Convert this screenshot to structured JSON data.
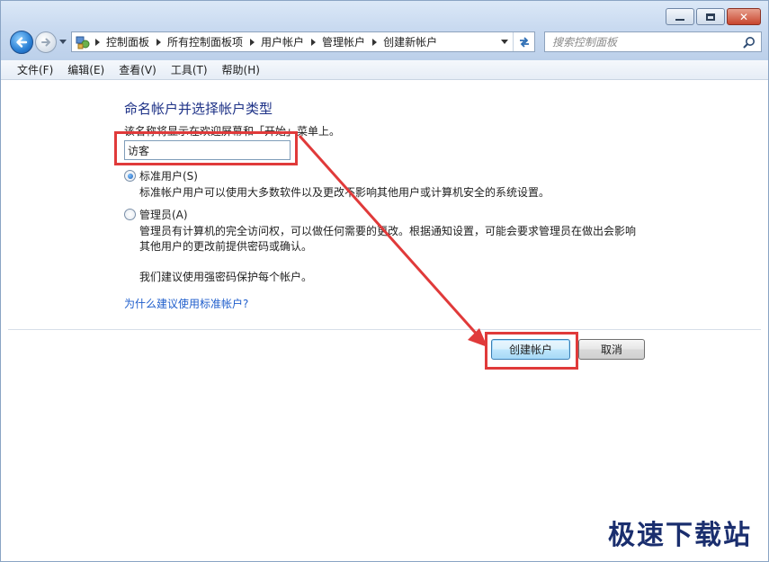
{
  "window": {
    "controls": {
      "minimize": "minimize",
      "maximize": "maximize",
      "close": "close"
    }
  },
  "nav": {
    "breadcrumbs": [
      "控制面板",
      "所有控制面板项",
      "用户帐户",
      "管理帐户",
      "创建新帐户"
    ]
  },
  "search": {
    "placeholder": "搜索控制面板"
  },
  "menu": [
    "文件(F)",
    "编辑(E)",
    "查看(V)",
    "工具(T)",
    "帮助(H)"
  ],
  "form": {
    "heading": "命名帐户并选择帐户类型",
    "description": "该名称将显示在欢迎屏幕和「开始」菜单上。",
    "account_name_value": "访客",
    "options": [
      {
        "label": "标准用户(S)",
        "selected": true,
        "description": [
          "标准帐户用户可以使用大多数软件以及更改不影响其他用户或计算机安全的系统设置。"
        ]
      },
      {
        "label": "管理员(A)",
        "selected": false,
        "description": [
          "管理员有计算机的完全访问权，可以做任何需要的更改。根据通知设置，可能会要求管理员在做出会影响",
          "其他用户的更改前提供密码或确认。"
        ]
      }
    ],
    "recommendation": "我们建议使用强密码保护每个帐户。",
    "help_link": "为什么建议使用标准帐户?"
  },
  "buttons": {
    "create": "创建帐户",
    "cancel": "取消"
  },
  "annotation": {
    "color": "#e03a3a"
  },
  "watermark": "极速下载站",
  "colors": {
    "heading": "#1e3287",
    "link": "#1f5ecc",
    "annotation": "#e03a3a"
  }
}
